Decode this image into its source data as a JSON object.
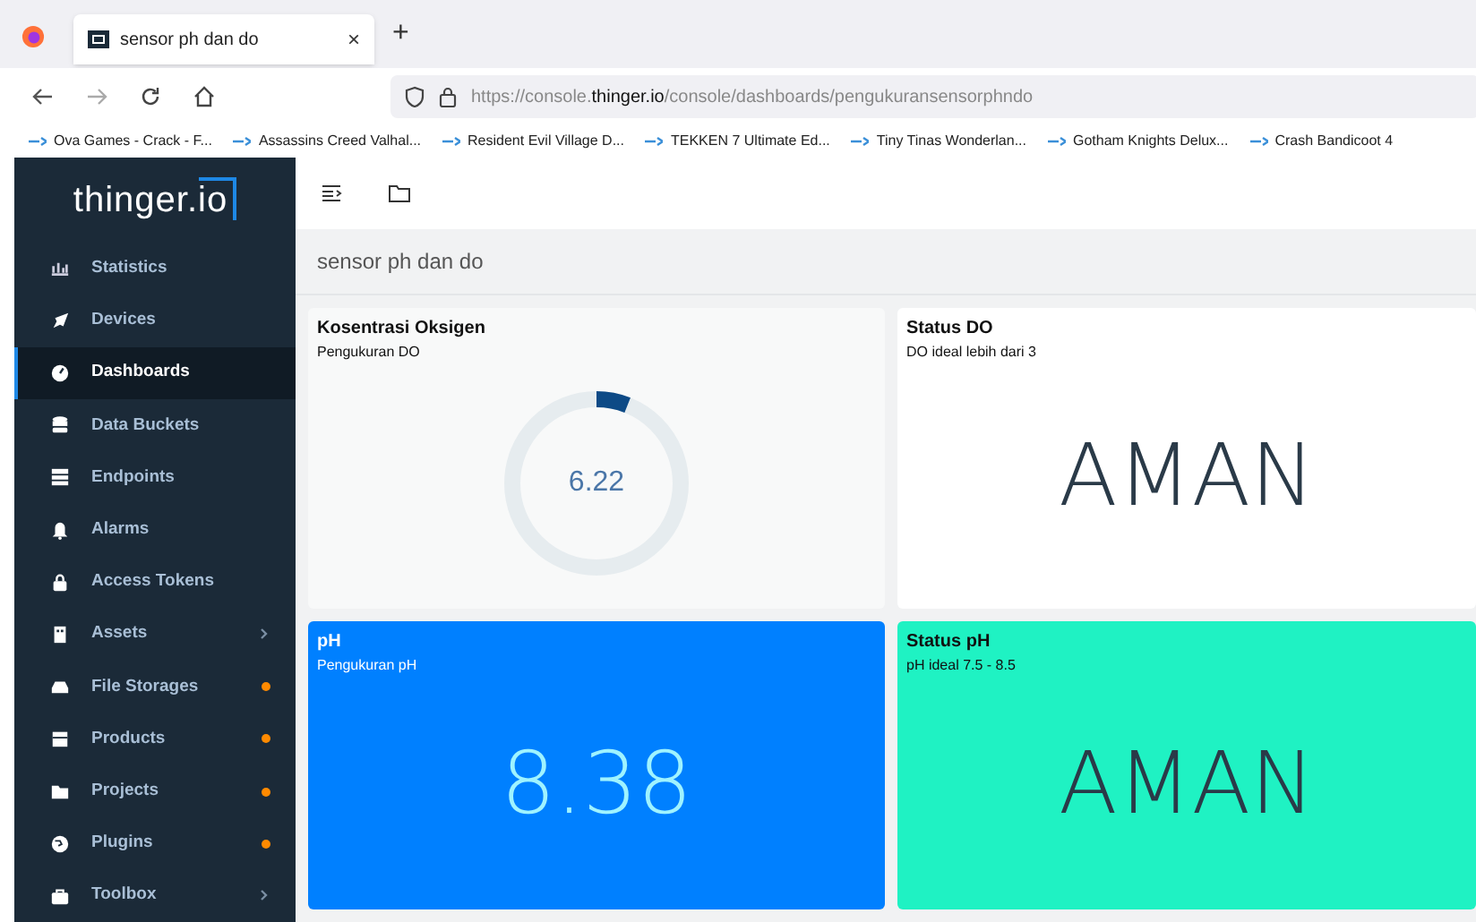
{
  "browser": {
    "tab": {
      "title": "sensor ph dan do",
      "selected": true,
      "close": "×"
    },
    "new_tab": "+",
    "url": {
      "prefix": "https://console.",
      "host": "thinger.io",
      "path": "/console/dashboards/pengukuransensorphndo"
    },
    "bookmarks": [
      "Ova Games - Crack - F...",
      "Assassins Creed Valhal...",
      "Resident Evil Village D...",
      "TEKKEN 7 Ultimate Ed...",
      "Tiny Tinas Wonderlan...",
      "Gotham Knights Delux...",
      "Crash Bandicoot 4"
    ]
  },
  "sidebar": {
    "logo": {
      "text": "thinger.",
      "boxed": "io"
    },
    "items": [
      {
        "label": "Statistics",
        "selected": false,
        "kind": "plain"
      },
      {
        "label": "Devices",
        "selected": false,
        "kind": "plain"
      },
      {
        "label": "Dashboards",
        "selected": true,
        "kind": "plain"
      },
      {
        "label": "Data Buckets",
        "selected": false,
        "kind": "plain"
      },
      {
        "label": "Endpoints",
        "selected": false,
        "kind": "plain"
      },
      {
        "label": "Alarms",
        "selected": false,
        "kind": "plain"
      },
      {
        "label": "Access Tokens",
        "selected": false,
        "kind": "plain"
      },
      {
        "label": "Assets",
        "selected": false,
        "kind": "submenu"
      },
      {
        "label": "File Storages",
        "selected": false,
        "kind": "flagged"
      },
      {
        "label": "Products",
        "selected": false,
        "kind": "flagged"
      },
      {
        "label": "Projects",
        "selected": false,
        "kind": "flagged"
      },
      {
        "label": "Plugins",
        "selected": false,
        "kind": "flagged"
      },
      {
        "label": "Toolbox",
        "selected": false,
        "kind": "submenu"
      }
    ]
  },
  "dashboard": {
    "title": "sensor ph dan do",
    "widgets": [
      {
        "kind": "gauge",
        "title": "Kosentrasi Oksigen",
        "subtitle": "Pengukuran DO",
        "value": "6.22",
        "level": 0.06,
        "color": "#f8f9f9"
      },
      {
        "kind": "text",
        "title": "Status DO",
        "subtitle": "DO ideal lebih dari 3",
        "value": "AMAN",
        "color": "#ffffff"
      },
      {
        "kind": "text",
        "title": "pH",
        "subtitle": "Pengukuran pH",
        "value": "8.38",
        "color": "#0080ff"
      },
      {
        "kind": "text",
        "title": "Status pH",
        "subtitle": "pH ideal 7.5 - 8.5",
        "value": "AMAN",
        "color": "#1ff2c3"
      }
    ]
  }
}
